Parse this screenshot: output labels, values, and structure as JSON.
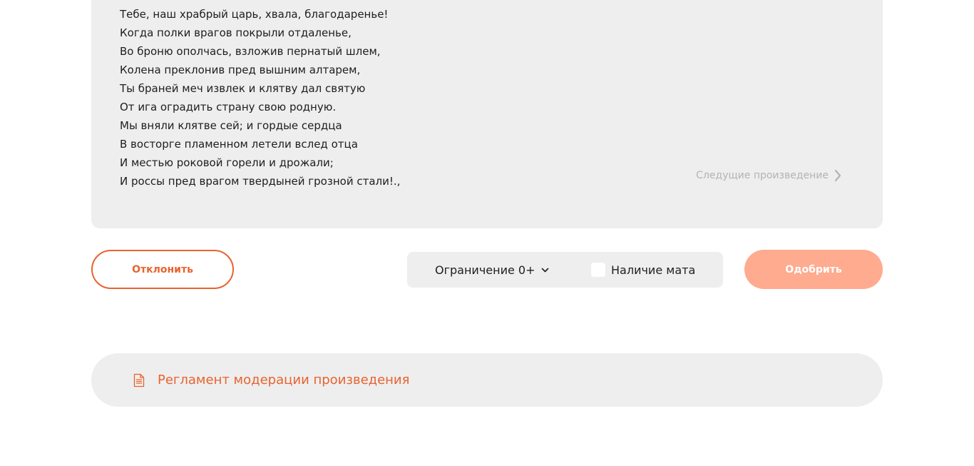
{
  "poem": {
    "lines": [
      "Тебе, наш храбрый царь, хвала, благодаренье!",
      "Когда полки врагов покрыли отдаленье,",
      "Во броню ополчась, взложив пернатый шлем,",
      "Колена преклонив пред вышним алтарем,",
      "Ты браней меч извлек и клятву дал святую",
      "От ига оградить страну свою родную.",
      "Мы вняли клятве сей; и гордые сердца",
      "В восторге пламенном летели вслед отца",
      "И местью роковой горели и дрожали;",
      "И россы пред врагом твердыней грозной стали!.,"
    ],
    "next_label": "Следущие произведение",
    "next_icon": "chevron-right-icon"
  },
  "actions": {
    "reject_label": "Отклонить",
    "restriction_label": "Ограничение 0+",
    "restriction_icon": "chevron-down-icon",
    "profanity_label": "Наличие мата",
    "profanity_checked": false,
    "approve_label": "Одобрить"
  },
  "rules": {
    "label": "Регламент модерации произведения",
    "icon": "document-icon"
  },
  "colors": {
    "accent": "#e8632f",
    "approve_bg": "#ffab8f",
    "card_bg": "#eeeeee",
    "muted_text": "#b3b3b3"
  }
}
